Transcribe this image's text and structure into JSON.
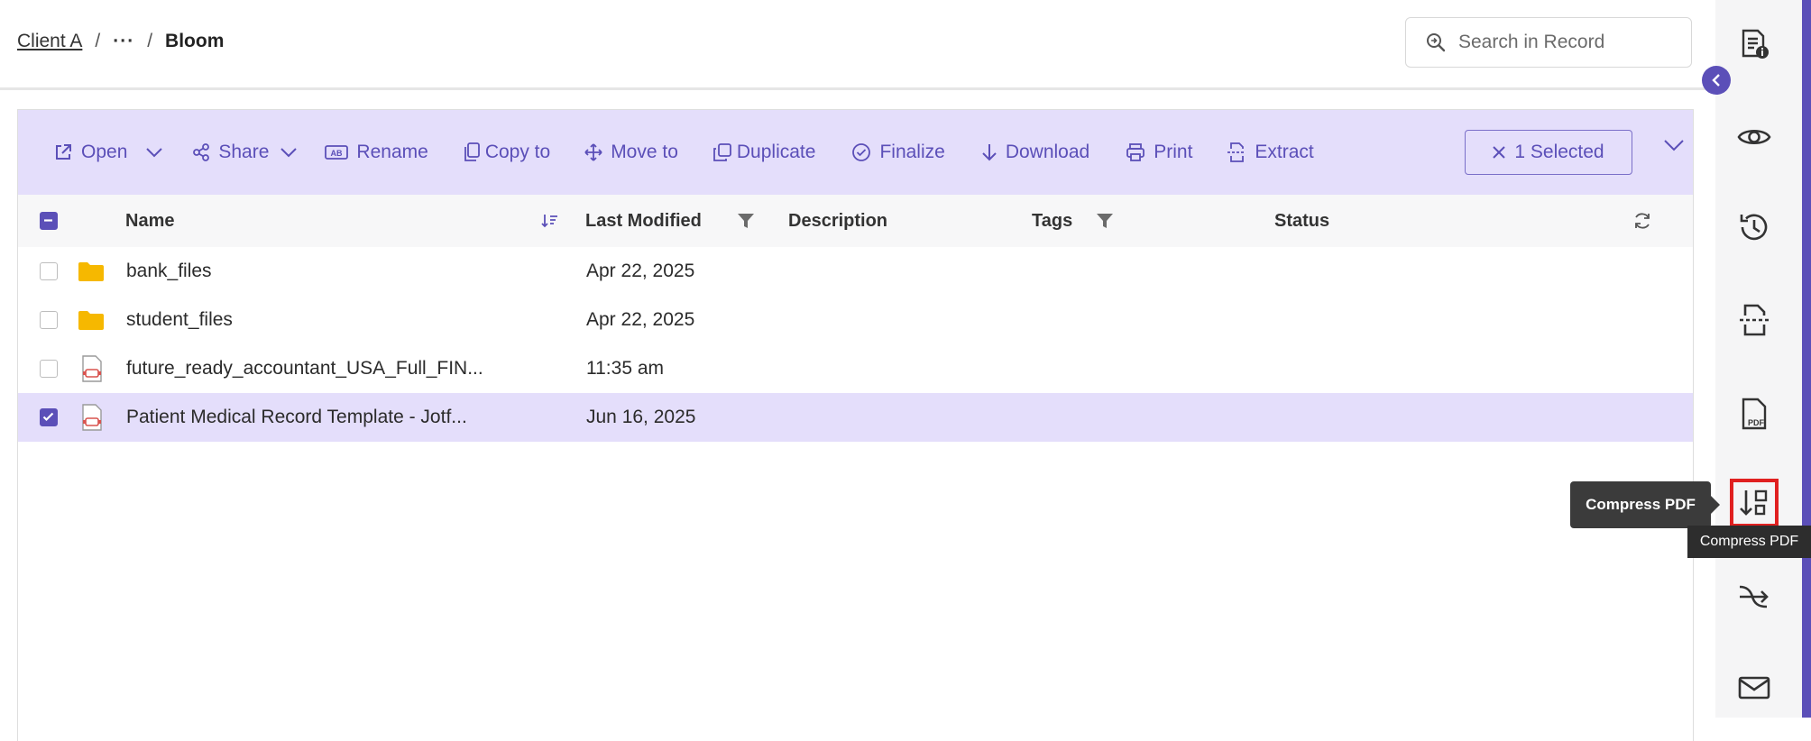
{
  "breadcrumb": {
    "root": "Client A",
    "ellipsis": "···",
    "current": "Bloom",
    "separator": "/"
  },
  "search": {
    "placeholder": "Search in Record"
  },
  "toolbar": {
    "open": "Open",
    "share": "Share",
    "rename": "Rename",
    "copy_to": "Copy to",
    "move_to": "Move to",
    "duplicate": "Duplicate",
    "finalize": "Finalize",
    "download": "Download",
    "print": "Print",
    "extract": "Extract",
    "selected": "1 Selected"
  },
  "table": {
    "columns": {
      "name": "Name",
      "last_modified": "Last Modified",
      "description": "Description",
      "tags": "Tags",
      "status": "Status"
    },
    "rows": [
      {
        "type": "folder",
        "name": "bank_files",
        "modified": "Apr 22, 2025",
        "checked": false
      },
      {
        "type": "pdf",
        "name": "student_files",
        "modified": "Apr 22, 2025",
        "checked": false
      },
      {
        "type": "pdf",
        "name": "future_ready_accountant_USA_Full_FIN...",
        "modified": "11:35 am",
        "checked": false
      },
      {
        "type": "pdf",
        "name": "Patient Medical Record Template - Jotf...",
        "modified": "Jun 16, 2025",
        "checked": true
      }
    ]
  },
  "rail": {
    "icons": [
      "document-info-icon",
      "eye-icon",
      "history-icon",
      "extract-icon",
      "pdf-file-icon",
      "compress-pdf-icon",
      "merge-icon",
      "mail-icon"
    ],
    "active": "compress-pdf-icon"
  },
  "tooltip": {
    "label": "Compress PDF",
    "native": "Compress PDF"
  },
  "colors": {
    "accent": "#5b4fb8",
    "toolbar_bg": "#e4defb",
    "folder": "#f6b800",
    "pdf": "#d9534f",
    "highlight": "#e02020"
  }
}
